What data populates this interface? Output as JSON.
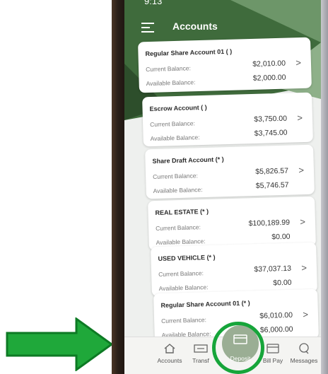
{
  "status_bar": {
    "time": "9:13"
  },
  "header": {
    "title": "Accounts"
  },
  "accounts": [
    {
      "name": "Regular Share Account 01 (       )",
      "current_label": "Current Balance:",
      "current": "$2,010.00",
      "available_label": "Available Balance:",
      "available": "$2,000.00"
    },
    {
      "name": "Escrow Account (        )",
      "current_label": "Current Balance:",
      "current": "$3,750.00",
      "available_label": "Available Balance:",
      "available": "$3,745.00"
    },
    {
      "name": "Share Draft Account (*       )",
      "current_label": "Current Balance:",
      "current": "$5,826.57",
      "available_label": "Available Balance:",
      "available": "$5,746.57"
    },
    {
      "name": "REAL ESTATE (*       )",
      "current_label": "Current Balance:",
      "current": "$100,189.99",
      "available_label": "Available Balance:",
      "available": "$0.00"
    },
    {
      "name": "USED VEHICLE (*       )",
      "current_label": "Current Balance:",
      "current": "$37,037.13",
      "available_label": "Available Balance:",
      "available": "$0.00"
    },
    {
      "name": "Regular Share Account 01 (*       )",
      "current_label": "Current Balance:",
      "current": "$6,010.00",
      "available_label": "Available Balance:",
      "available": "$6,000.00"
    }
  ],
  "bottom_nav": {
    "accounts": "Accounts",
    "transfers": "Transf",
    "deposit": "Deposit",
    "bill_pay": "Bill Pay",
    "messages": "Messages"
  },
  "colors": {
    "header_green": "#3f6b3c",
    "accent_sage": "#9aae94",
    "highlight_green": "#16a53a",
    "arrow_green": "#1fa83a"
  }
}
